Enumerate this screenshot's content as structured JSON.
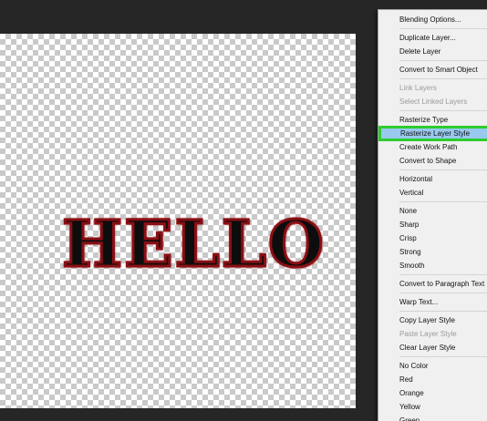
{
  "canvas": {
    "text": "HELLO",
    "text_color": "#0d0d0d",
    "stroke_color": "#8a0f14"
  },
  "menu": {
    "highlight_color": "#99c9ef",
    "callout_color": "#2ecc2e",
    "groups": [
      [
        "Blending Options..."
      ],
      [
        "Duplicate Layer...",
        "Delete Layer"
      ],
      [
        "Convert to Smart Object"
      ],
      [
        "Link Layers",
        "Select Linked Layers"
      ],
      [
        "Rasterize Type",
        "Rasterize Layer Style",
        "Create Work Path",
        "Convert to Shape"
      ],
      [
        "Horizontal",
        "Vertical"
      ],
      [
        "None",
        "Sharp",
        "Crisp",
        "Strong",
        "Smooth"
      ],
      [
        "Convert to Paragraph Text"
      ],
      [
        "Warp Text..."
      ],
      [
        "Copy Layer Style",
        "Paste Layer Style",
        "Clear Layer Style"
      ],
      [
        "No Color",
        "Red",
        "Orange",
        "Yellow",
        "Green"
      ]
    ],
    "disabled_items": [
      "Link Layers",
      "Select Linked Layers",
      "Paste Layer Style"
    ],
    "highlighted_item": "Rasterize Layer Style"
  }
}
